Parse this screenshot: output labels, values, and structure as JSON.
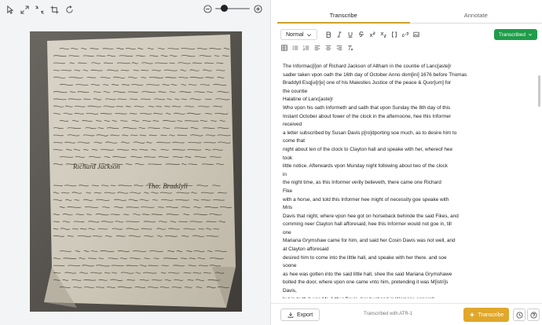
{
  "tabs": [
    {
      "label": "Transcribe",
      "active": true
    },
    {
      "label": "Annotate",
      "active": false
    }
  ],
  "editor": {
    "style_value": "Normal",
    "status_label": "Transcribed",
    "lines": [
      "The Informac[i]on of Richard Jackson of Altham in the countie of Lanc[aste]r",
      "sadler taken vpon oath the 16th day of October Anno dom[ini] 1676 before Thomas",
      "Braddyll Esq[ui]r[e] one of his Maiesties Justice of the peace & Quor[um] for",
      "the countie",
      "Halatine of Lanc[aste]r",
      "Who vpon his oath Informeth and saith that vpon Sunday the 8th day of this",
      "Instant October about fower of the clock in the afternoone, hee this Informer",
      "received",
      "a letter subscribed by Susan Davis p[ro]dporting soe much, as to desire him to",
      "come that",
      "night about ten of the clock to Clayton hall and speake with her, whereof hee",
      "took",
      "little notice. Afterwards vpon Munday night following about two of the clock",
      "in",
      "the night time, as this Informer verily believeth, there came one Richard",
      "Fike",
      "with a horse, and told this Informer hee might of necessity goe speake with",
      "Mris",
      "Davis that night, where vpon hee got on horseback behinde the said Fikes, and",
      "comming neer Clayton hall afforesaid, hee this Informer would not goe in, till",
      "one",
      "Mariana Grymshaw came for him, and said her Cosin Davis was not well, and",
      "at Clayton afforesaid",
      "desired him to come into the little hall, and speake with her there. and soe",
      "soone",
      "as hee was gotten into the said little hall, shee the said Mariana Grymshawe",
      "bolted the door, where vpon one came vnto him, pretending it was M[istri]s",
      "Davis,",
      "but in truth it was Mr. Arthur Davis, her husband in Womans apparell",
      "and both hee the said Davis, and Richard Grymshaw of Clayton super Moores"
    ]
  },
  "bottom": {
    "export_label": "Export",
    "model_label": "Transcribed with ATR-1",
    "transcribe_label": "Transcribe"
  },
  "zoom": {
    "level": 0.2
  },
  "colors": {
    "accent": "#e0a72a",
    "status": "#1f9d4a",
    "tab_underline": "#d0a128"
  }
}
